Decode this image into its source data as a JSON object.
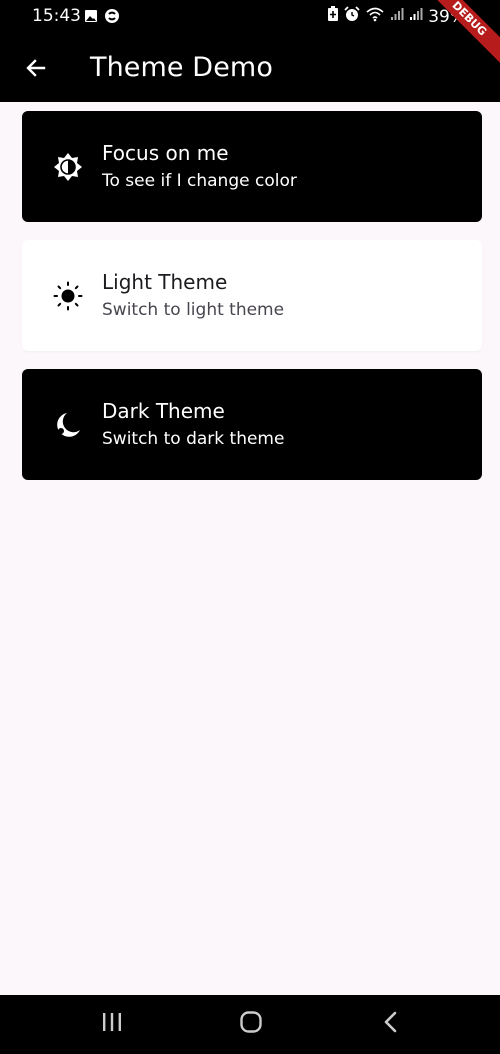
{
  "status_bar": {
    "time": "15:43",
    "battery_percent": "39%",
    "left_icons": [
      "image-icon",
      "sync-app-icon"
    ],
    "right_icons": [
      "battery-saver-icon",
      "alarm-icon",
      "wifi-icon",
      "signal-icon",
      "signal-icon"
    ]
  },
  "app_bar": {
    "title": "Theme Demo",
    "back_icon": "arrow-back-icon",
    "debug_banner": "DEBUG"
  },
  "cards": [
    {
      "title": "Focus on me",
      "subtitle": "To see if I change color",
      "icon": "brightness-icon",
      "style": "dark"
    },
    {
      "title": "Light Theme",
      "subtitle": "Switch to light theme",
      "icon": "sun-icon",
      "style": "light"
    },
    {
      "title": "Dark Theme",
      "subtitle": "Switch to dark theme",
      "icon": "moon-icon",
      "style": "dark"
    }
  ],
  "nav_bar": {
    "buttons": [
      "recent-apps-icon",
      "home-icon",
      "back-icon"
    ]
  },
  "colors": {
    "background": "#fcf7fb",
    "app_bar": "#000000",
    "dark_card": "#000000",
    "light_card": "#ffffff",
    "debug_ribbon": "#b71c1c"
  }
}
